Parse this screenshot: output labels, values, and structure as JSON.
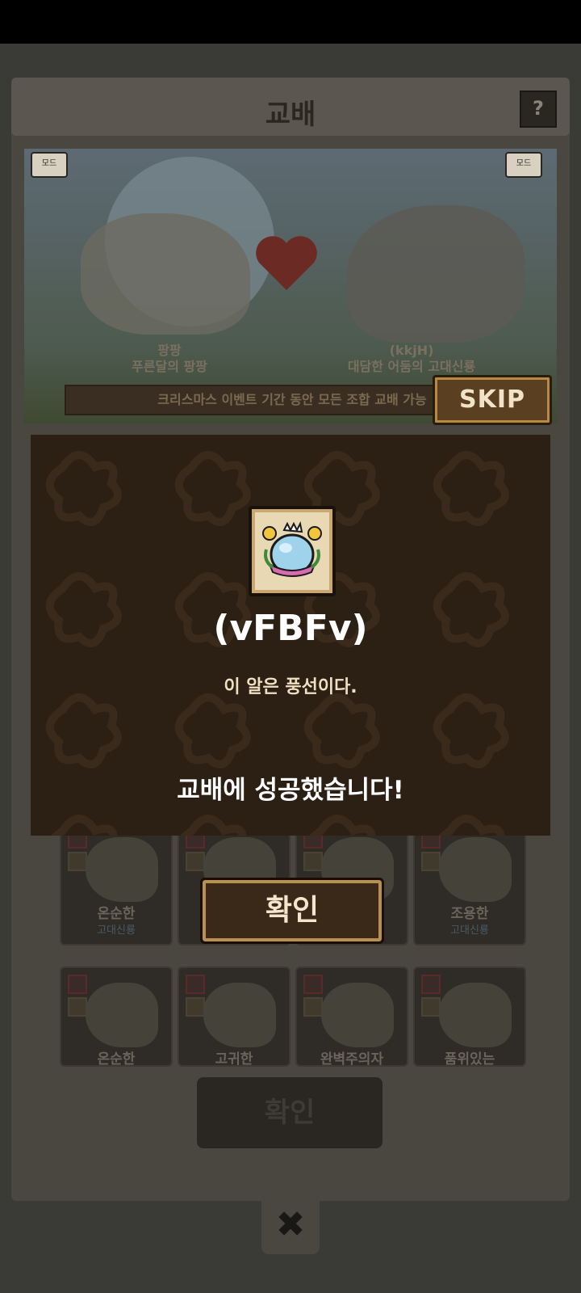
{
  "header": {
    "title": "교배",
    "help_label": "?"
  },
  "scene": {
    "left_badge": "모드",
    "right_badge": "모드",
    "left_dragon_name": "팡팡",
    "left_dragon_sub": "푸른달의 팡팡",
    "right_dragon_name": "(kkjH)",
    "right_dragon_sub": "대담한 어둠의 고대신룡"
  },
  "event_banner": "크리스마스 이벤트 기간 동안 모든 조합 교배 가능",
  "skip_label": "SKIP",
  "grid": {
    "row1": [
      {
        "name": "온순한",
        "sub": "고대신룡"
      },
      {
        "name": "",
        "sub": ""
      },
      {
        "name": "",
        "sub": ""
      },
      {
        "name": "조용한",
        "sub": "고대신룡"
      }
    ],
    "row2": [
      {
        "name": "온순한",
        "sub": ""
      },
      {
        "name": "고귀한",
        "sub": ""
      },
      {
        "name": "완벽주의자",
        "sub": ""
      },
      {
        "name": "품위있는",
        "sub": ""
      }
    ]
  },
  "bottom_confirm_label": "확인",
  "close_label": "✖",
  "dialog": {
    "item_name": "(vFBFv)",
    "item_desc": "이 알은 풍선이다.",
    "success_message": "교배에 성공했습니다!",
    "confirm_label": "확인"
  },
  "colors": {
    "dialog_bg": "#2c1f14",
    "button_border": "#b89050",
    "text_primary": "#ffffff"
  }
}
